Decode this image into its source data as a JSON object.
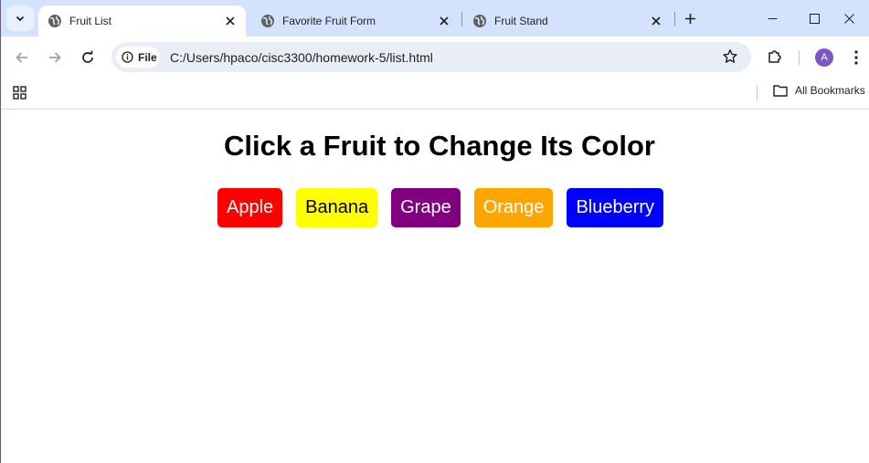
{
  "browser": {
    "tabs": [
      {
        "title": "Fruit List",
        "active": true
      },
      {
        "title": "Favorite Fruit Form",
        "active": false
      },
      {
        "title": "Fruit Stand",
        "active": false
      }
    ],
    "address": {
      "scheme_label": "File",
      "url": "C:/Users/hpaco/cisc3300/homework-5/list.html"
    },
    "profile_initial": "A",
    "bookmarks": {
      "all_bookmarks_label": "All Bookmarks"
    }
  },
  "page": {
    "heading": "Click a Fruit to Change Its Color",
    "fruits": [
      {
        "label": "Apple",
        "bg": "#ff0000",
        "fg": "#ffffff"
      },
      {
        "label": "Banana",
        "bg": "#ffff00",
        "fg": "#000000"
      },
      {
        "label": "Grape",
        "bg": "#800080",
        "fg": "#ffffff"
      },
      {
        "label": "Orange",
        "bg": "#ffa500",
        "fg": "#ffffff"
      },
      {
        "label": "Blueberry",
        "bg": "#0000ff",
        "fg": "#ffffff"
      }
    ]
  },
  "colors": {
    "tabstrip": "#d3e3fd",
    "omnibox": "#e9eef6",
    "avatar": "#7e57c2"
  }
}
